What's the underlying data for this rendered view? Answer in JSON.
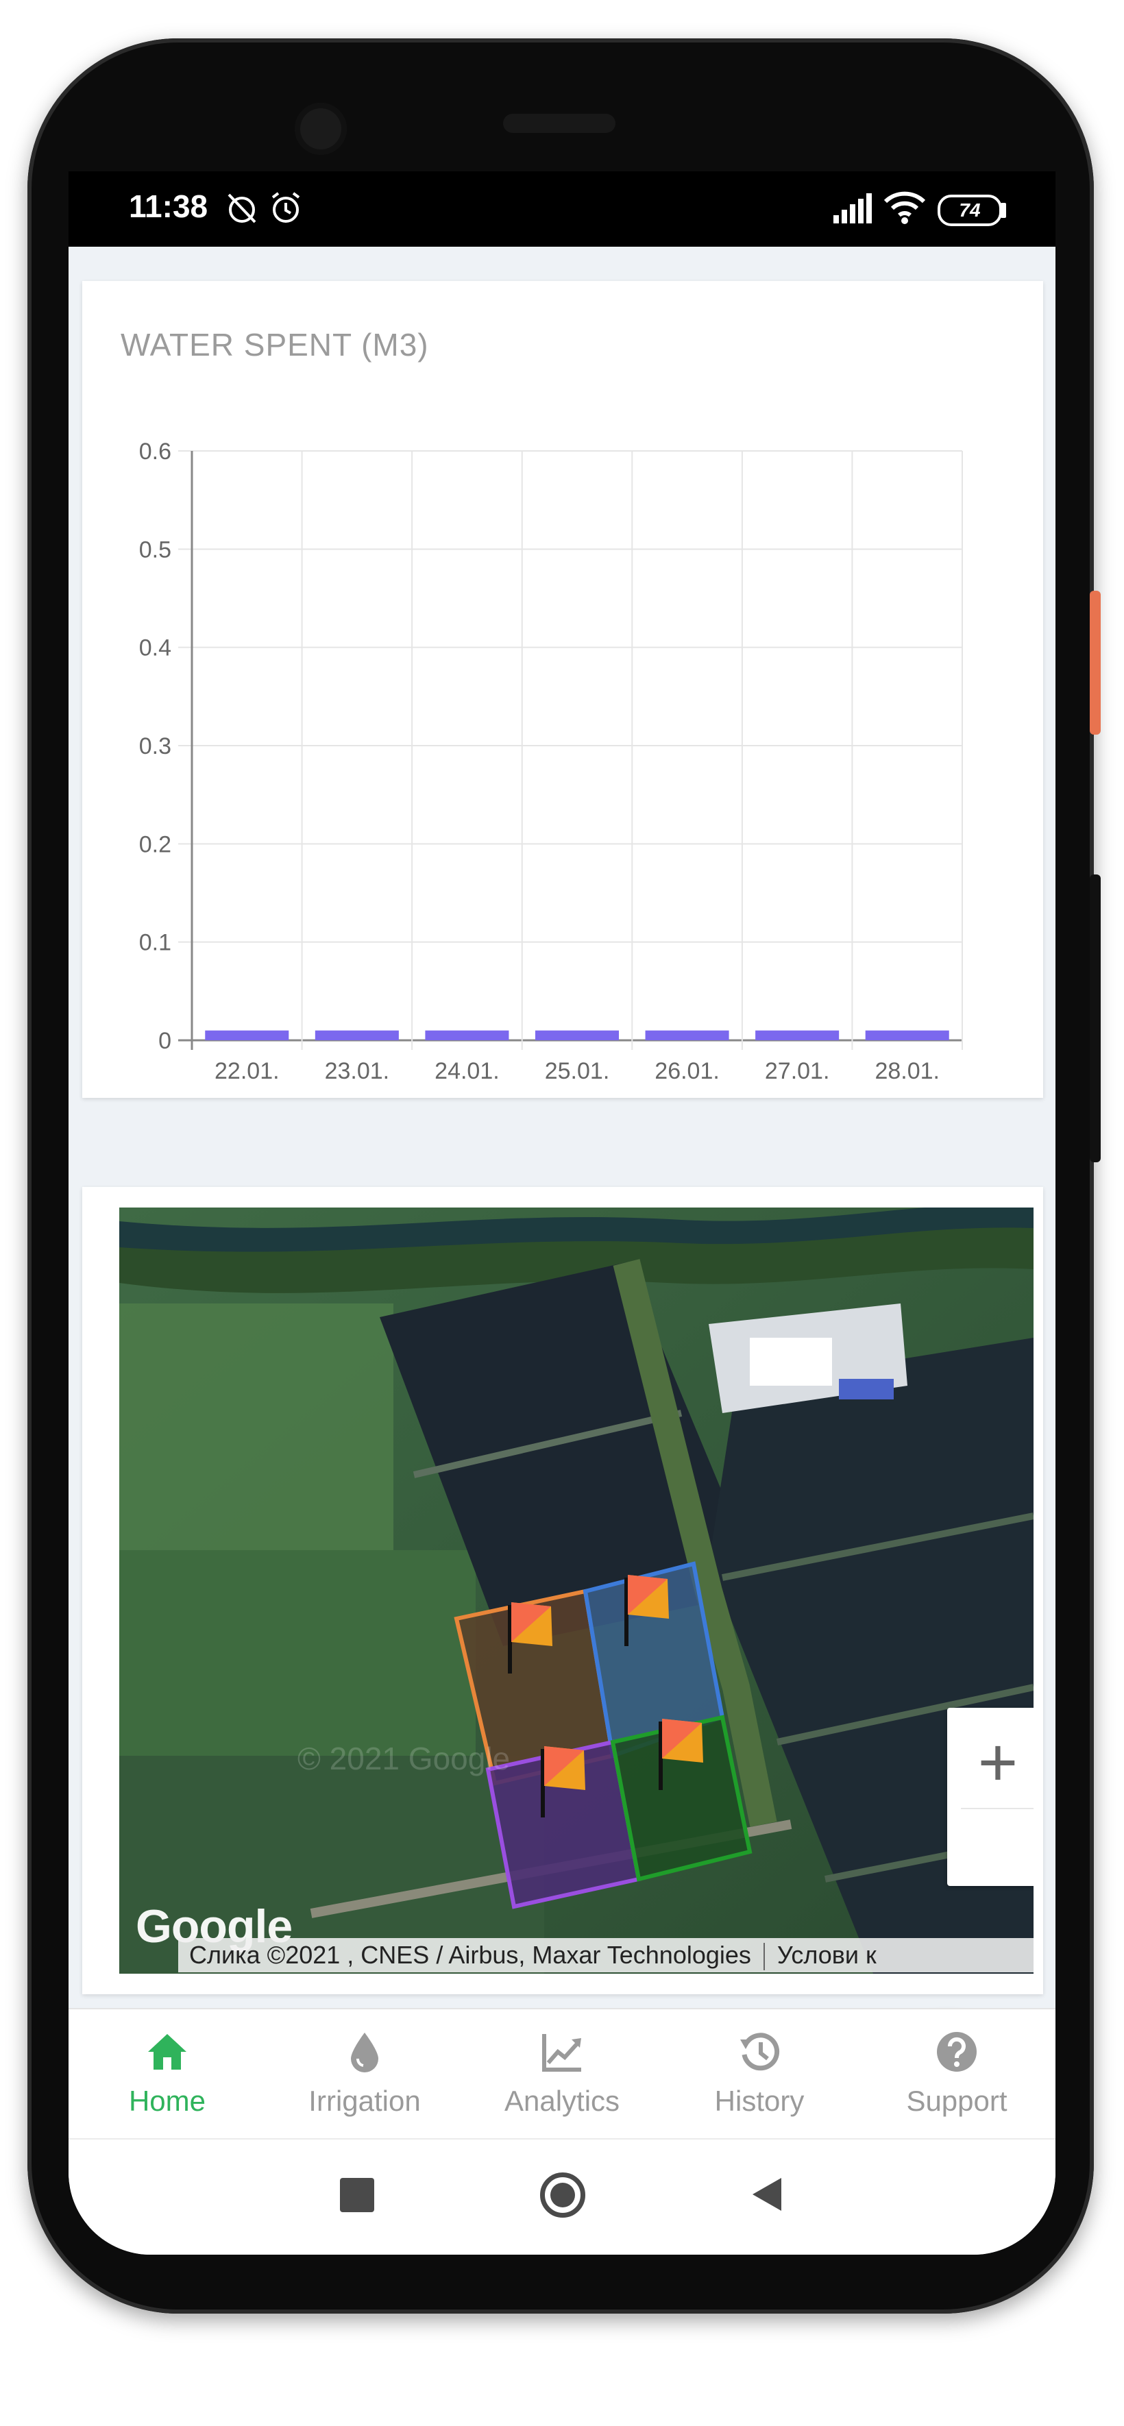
{
  "status_bar": {
    "time": "11:38",
    "battery": "74"
  },
  "chart_card": {
    "title": "WATER SPENT (M3)",
    "chart_data": {
      "type": "bar",
      "categories": [
        "22.01.",
        "23.01.",
        "24.01.",
        "25.01.",
        "26.01.",
        "27.01.",
        "28.01."
      ],
      "values": [
        0.01,
        0.01,
        0.01,
        0.01,
        0.01,
        0.01,
        0.01
      ],
      "yticks": [
        "0",
        "0.1",
        "0.2",
        "0.3",
        "0.4",
        "0.5",
        "0.6"
      ],
      "ylim": [
        0,
        0.6
      ],
      "grid": true,
      "bar_color": "#7b68ee"
    }
  },
  "map_card": {
    "zoom_in_label": "+",
    "logo_text": "Google",
    "watermark": "© 2021 Google",
    "attribution": "Слика ©2021 , CNES / Airbus, Maxar Technologies",
    "terms": "Услови к",
    "fields": [
      {
        "name": "field-orange",
        "color": "#e8863a"
      },
      {
        "name": "field-blue",
        "color": "#3d7bd9"
      },
      {
        "name": "field-purple",
        "color": "#9a4fe0"
      },
      {
        "name": "field-green",
        "color": "#1f9d2a"
      }
    ]
  },
  "fab": {
    "label": "+"
  },
  "bottom_nav": {
    "items": [
      {
        "label": "Home",
        "icon": "home-icon",
        "active": true
      },
      {
        "label": "Irrigation",
        "icon": "water-drop-icon",
        "active": false
      },
      {
        "label": "Analytics",
        "icon": "chart-line-icon",
        "active": false
      },
      {
        "label": "History",
        "icon": "history-icon",
        "active": false
      },
      {
        "label": "Support",
        "icon": "help-circle-icon",
        "active": false
      }
    ]
  },
  "colors": {
    "accent": "#2fb35b",
    "inactive": "#9a9a9a"
  }
}
